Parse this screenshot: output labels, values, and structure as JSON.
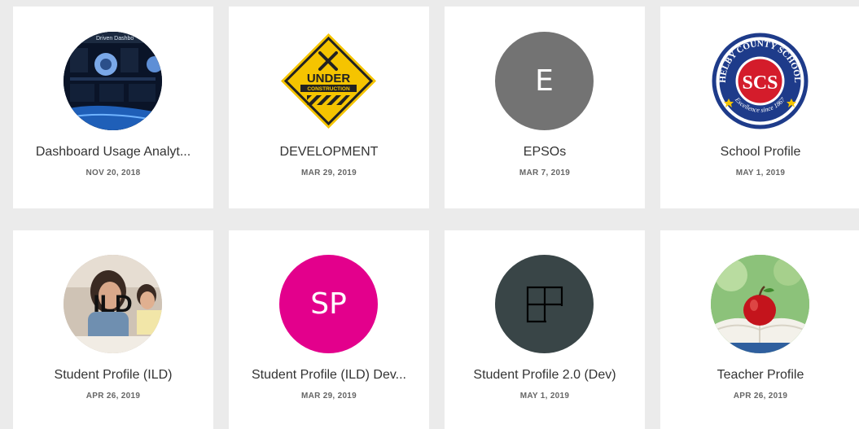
{
  "cards": [
    {
      "title": "Dashboard Usage Analyt...",
      "date": "NOV 20, 2018",
      "avatar": {
        "type": "image",
        "icon": "dashboard-screenshot-icon",
        "overlay_text": "Driven Dashbo"
      }
    },
    {
      "title": "DEVELOPMENT",
      "date": "MAR 29, 2019",
      "avatar": {
        "type": "image",
        "icon": "under-construction-sign-icon",
        "sign_line1": "UNDER",
        "sign_line2": "CONSTRUCTION"
      }
    },
    {
      "title": "EPSOs",
      "date": "MAR 7, 2019",
      "avatar": {
        "type": "initials",
        "initials": "E",
        "color": "#737373"
      }
    },
    {
      "title": "School Profile",
      "date": "MAY 1, 2019",
      "avatar": {
        "type": "logo",
        "icon": "shelby-county-schools-seal-icon",
        "ring_top": "SHELBY COUNTY SCHOOLS",
        "center": "SCS",
        "ring_bottom": "Excellence since 1867"
      }
    },
    {
      "title": "Student Profile (ILD)",
      "date": "APR 26, 2019",
      "avatar": {
        "type": "image",
        "icon": "students-photo-icon",
        "overlay_text": "ILD"
      }
    },
    {
      "title": "Student Profile (ILD) Dev...",
      "date": "MAR 29, 2019",
      "avatar": {
        "type": "initials",
        "initials": "SP",
        "color": "#e3008c"
      }
    },
    {
      "title": "Student Profile 2.0 (Dev)",
      "date": "MAY 1, 2019",
      "avatar": {
        "type": "icon",
        "icon": "layout-grid-icon",
        "color": "#394547"
      }
    },
    {
      "title": "Teacher Profile",
      "date": "APR 26, 2019",
      "avatar": {
        "type": "image",
        "icon": "apple-on-book-photo-icon"
      }
    }
  ]
}
